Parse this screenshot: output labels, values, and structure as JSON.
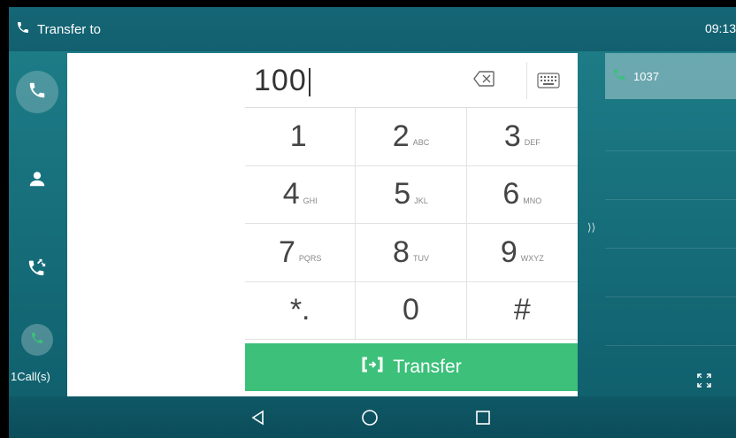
{
  "statusbar": {
    "title": "Transfer to",
    "clock": "09:13"
  },
  "rail": {
    "calls_count": "1Call(s)"
  },
  "dialpad": {
    "number": "100",
    "keys": [
      {
        "digit": "1",
        "letters": ""
      },
      {
        "digit": "2",
        "letters": "ABC"
      },
      {
        "digit": "3",
        "letters": "DEF"
      },
      {
        "digit": "4",
        "letters": "GHI"
      },
      {
        "digit": "5",
        "letters": "JKL"
      },
      {
        "digit": "6",
        "letters": "MNO"
      },
      {
        "digit": "7",
        "letters": "PQRS"
      },
      {
        "digit": "8",
        "letters": "TUV"
      },
      {
        "digit": "9",
        "letters": "WXYZ"
      },
      {
        "digit": "*.",
        "letters": ""
      },
      {
        "digit": "0",
        "letters": ""
      },
      {
        "digit": "#",
        "letters": ""
      }
    ],
    "transfer_label": "Transfer"
  },
  "calllist": {
    "items": [
      {
        "number": "1037"
      }
    ]
  },
  "colors": {
    "accent_green": "#3cc07a",
    "bg_teal": "#17707c"
  },
  "icons": [
    "phone-icon",
    "contact-icon",
    "call-forward-icon",
    "backspace-icon",
    "keyboard-icon",
    "transfer-icon",
    "fullscreen-icon",
    "back-icon",
    "home-icon",
    "recent-apps-icon"
  ]
}
